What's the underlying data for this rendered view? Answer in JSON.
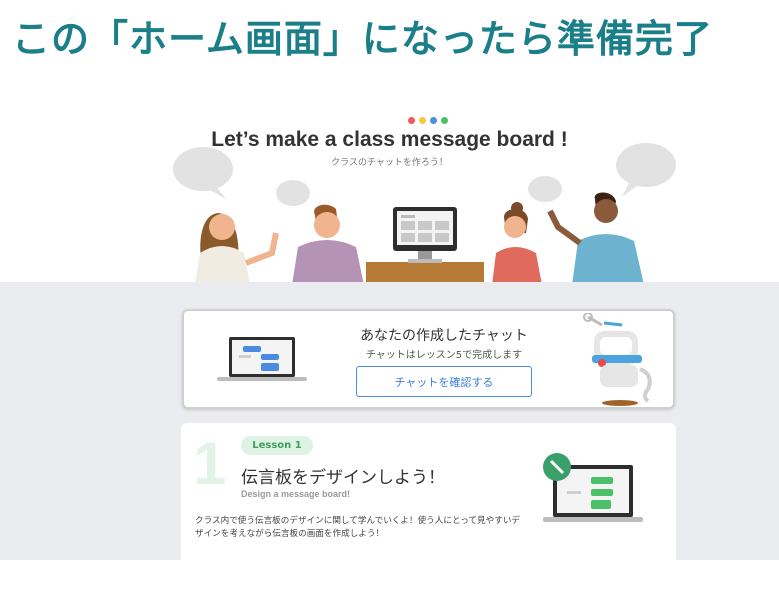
{
  "headline": "この「ホーム画面」になったら準備完了",
  "hero": {
    "dots": [
      "#f15b5b",
      "#f7c844",
      "#4a90e2",
      "#4cbf6a"
    ],
    "title": "Let’s make a class message board !",
    "subtitle": "クラスのチャットを作ろう！"
  },
  "chat_card": {
    "title": "あなたの作成したチャット",
    "description": "チャットはレッスン5で完成します",
    "button_label": "チャットを確認する"
  },
  "lesson": {
    "number": "1",
    "badge": "Lesson 1",
    "title": "伝言板をデザインしよう！",
    "subtitle_en": "Design a message board!",
    "description": "クラス内で使う伝言板のデザインに関して学んでいくよ！使う人にとって見やすいデザインを考えながら伝言板の画面を作成しよう！"
  },
  "icons": {
    "monitor": "monitor-icon",
    "laptop": "laptop-icon",
    "robot": "robot-mascot-icon",
    "pencil_badge": "pencil-badge-icon"
  }
}
